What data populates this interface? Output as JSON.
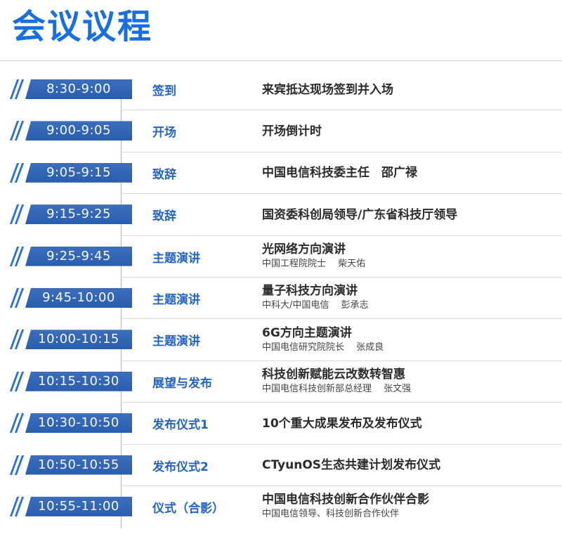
{
  "title": "会议议程",
  "agenda": [
    {
      "time": "8:30-9:00",
      "type": "签到",
      "main": "来宾抵达现场签到并入场",
      "sub": ""
    },
    {
      "time": "9:00-9:05",
      "type": "开场",
      "main": "开场倒计时",
      "sub": ""
    },
    {
      "time": "9:05-9:15",
      "type": "致辞",
      "main": "中国电信科技委主任　邵广禄",
      "sub": ""
    },
    {
      "time": "9:15-9:25",
      "type": "致辞",
      "main": "国资委科创局领导/广东省科技厅领导",
      "sub": ""
    },
    {
      "time": "9:25-9:45",
      "type": "主题演讲",
      "main": "光网络方向演讲",
      "sub": "中国工程院院士　 柴天佑"
    },
    {
      "time": "9:45-10:00",
      "type": "主题演讲",
      "main": "量子科技方向演讲",
      "sub": "中科大/中国电信　 彭承志"
    },
    {
      "time": "10:00-10:15",
      "type": "主题演讲",
      "main": "6G方向主题演讲",
      "sub": "中国电信研究院院长　 张成良"
    },
    {
      "time": "10:15-10:30",
      "type": "展望与发布",
      "main": "科技创新赋能云改数转智惠",
      "sub": "中国电信科技创新部总经理　 张文强"
    },
    {
      "time": "10:30-10:50",
      "type": "发布仪式1",
      "main": "10个重大成果发布及发布仪式",
      "sub": ""
    },
    {
      "time": "10:50-10:55",
      "type": "发布仪式2",
      "main": "CTyunOS生态共建计划发布仪式",
      "sub": ""
    },
    {
      "time": "10:55-11:00",
      "type": "仪式（合影）",
      "main": "中国电信科技创新合作伙伴合影",
      "sub": "中国电信领导、科技创新合作伙伴"
    }
  ]
}
